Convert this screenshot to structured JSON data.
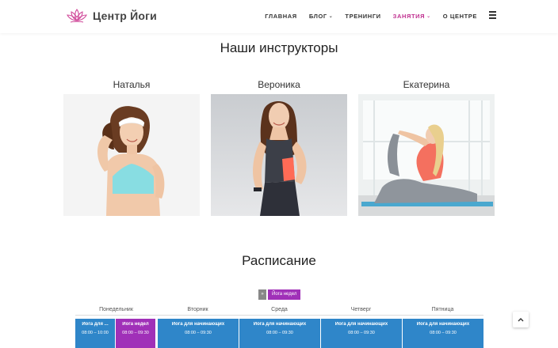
{
  "header": {
    "logo_text": "Центр Йоги",
    "nav": [
      {
        "label": "ГЛАВНАЯ",
        "has_caret": false,
        "active": false
      },
      {
        "label": "БЛОГ",
        "has_caret": true,
        "active": false
      },
      {
        "label": "ТРЕНИНГИ",
        "has_caret": false,
        "active": false
      },
      {
        "label": "ЗАНЯТИЯ",
        "has_caret": true,
        "active": true
      },
      {
        "label": "О ЦЕНТРЕ",
        "has_caret": false,
        "active": false
      }
    ],
    "caret_glyph": "⌄",
    "accent_color": "#c03090"
  },
  "instructors": {
    "title": "Наши инструкторы",
    "items": [
      {
        "name": "Наталья"
      },
      {
        "name": "Вероника"
      },
      {
        "name": "Екатерина"
      }
    ]
  },
  "schedule": {
    "title": "Расписание",
    "toggle_small": "»",
    "toggle_main": "Йога недел",
    "days": [
      "Понедельник",
      "Вторник",
      "Среда",
      "Четверг",
      "Пятница"
    ],
    "cells": [
      {
        "name": "Йога для ...",
        "time": "08:00 – 10:00",
        "color": "#2f86c9"
      },
      {
        "name": "Йога недел",
        "time": "08:00 – 09:30",
        "color": "#a030b8"
      },
      {
        "name": "Йога для начинающих",
        "time": "08:00 – 09:30",
        "color": "#2f86c9"
      },
      {
        "name": "Йога для начинающих",
        "time": "08:00 – 09:30",
        "color": "#2f86c9"
      },
      {
        "name": "Йога для начинающих",
        "time": "08:00 – 09:30",
        "color": "#2f86c9"
      },
      {
        "name": "Йога для начинающих",
        "time": "08:00 – 09:30",
        "color": "#2f86c9"
      }
    ]
  },
  "icons": {
    "logo": "lotus-icon",
    "menu": "hamburger-icon",
    "scroll_top": "chevron-up-icon"
  }
}
